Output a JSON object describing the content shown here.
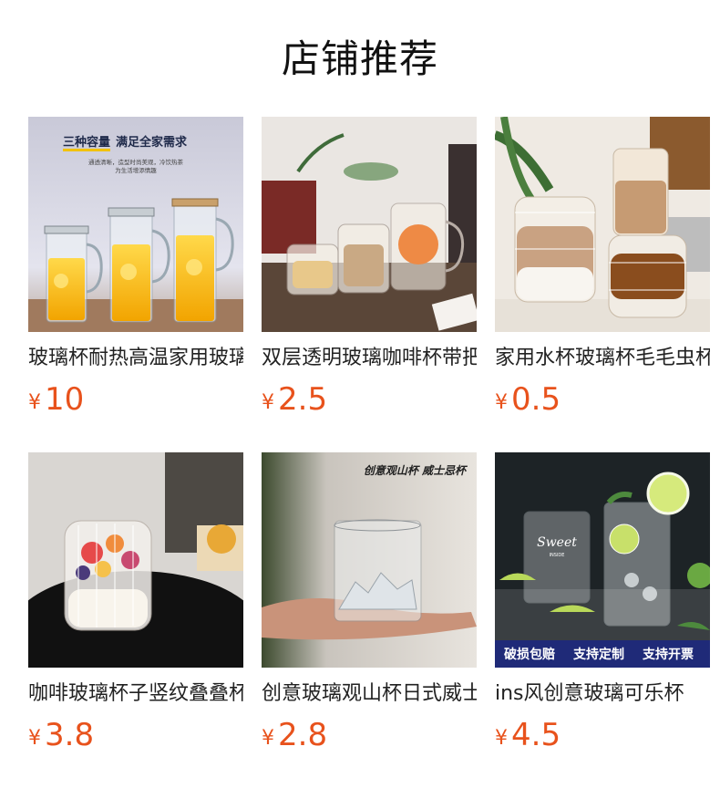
{
  "section": {
    "title": "店铺推荐"
  },
  "products": [
    {
      "name": "玻璃杯耐热高温家用玻璃",
      "currency": "¥",
      "price": "10",
      "image": {
        "description_icon": "glass-pitchers-image",
        "headline_prefix": "三种容量",
        "headline_suffix": "满足全家需求",
        "sub_line_1": "通透清晰，造型时尚美观，冷饮热茶",
        "sub_line_2": "为生活增添情趣"
      }
    },
    {
      "name": "双层透明玻璃咖啡杯带把",
      "currency": "¥",
      "price": "2.5",
      "image": {
        "description_icon": "double-wall-cups-image"
      }
    },
    {
      "name": "家用水杯玻璃杯毛毛虫杯",
      "currency": "¥",
      "price": "0.5",
      "image": {
        "description_icon": "ribbed-glasses-image"
      }
    },
    {
      "name": "咖啡玻璃杯子竖纹叠叠杯",
      "currency": "¥",
      "price": "3.8",
      "image": {
        "description_icon": "dessert-glass-image"
      }
    },
    {
      "name": "创意玻璃观山杯日式威士忌",
      "currency": "¥",
      "price": "2.8",
      "image": {
        "description_icon": "mountain-whisky-glass-image",
        "overlay_text": "创意观山杯 威士忌杯"
      }
    },
    {
      "name": "ins风创意玻璃可乐杯",
      "currency": "¥",
      "price": "4.5",
      "image": {
        "description_icon": "cola-glasses-image",
        "glass_script": "Sweet",
        "glass_small": "INSIDE",
        "banner_items": [
          "破损包赔",
          "支持定制",
          "支持开票"
        ]
      }
    }
  ]
}
